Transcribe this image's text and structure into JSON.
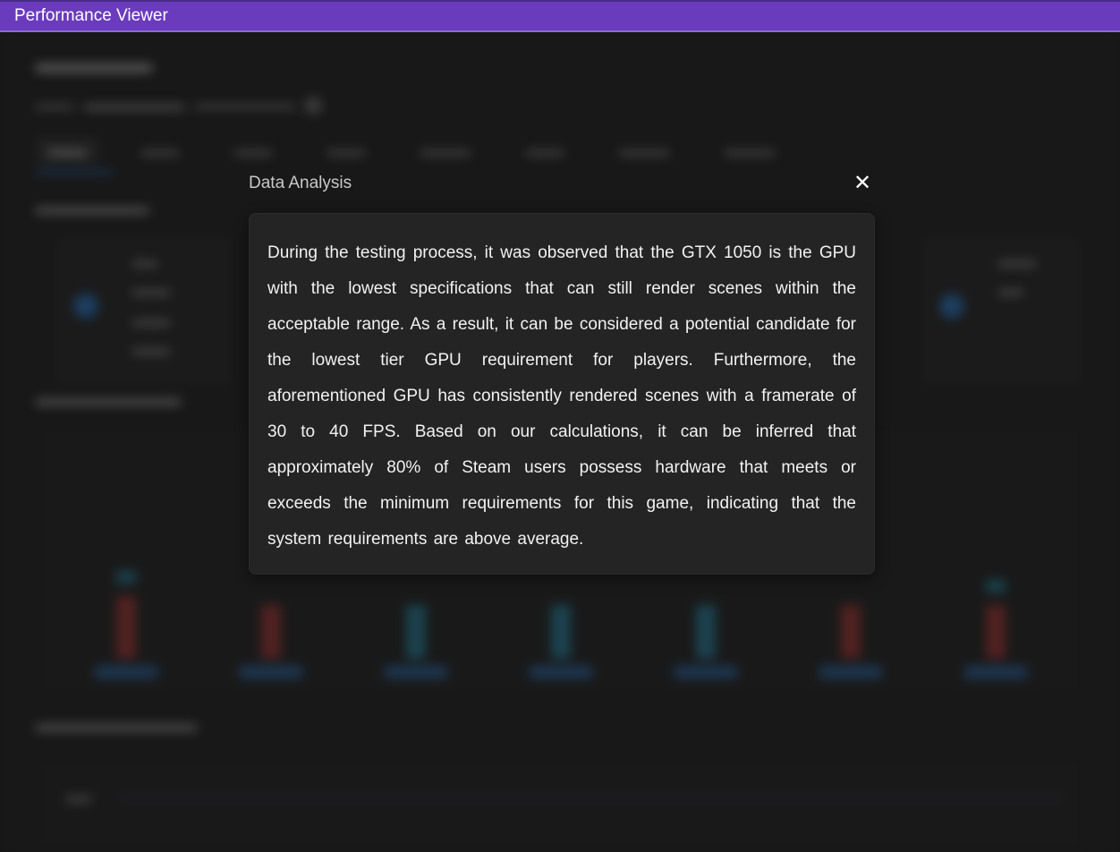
{
  "window": {
    "title": "Performance Viewer"
  },
  "dialog": {
    "title": "Data Analysis",
    "close_icon": "close-icon",
    "text": "During the testing process, it was observed that the GTX 1050 is the GPU with the lowest specifications that can still render scenes within the acceptable range. As a result, it can be considered a potential candidate for the lowest tier GPU requirement for players. Furthermore, the aforementioned GPU has consistently rendered scenes with a framerate of 30 to 40 FPS. Based on our calculations, it can be inferred that approximately 80% of Steam users possess hardware that meets or exceeds the minimum requirements for this game, indicating that the system requirements are above average."
  },
  "colors": {
    "titlebar": "#6a3bbd",
    "background": "#232323",
    "dialog_body": "#242424",
    "accent_blue": "#2f7fd0",
    "bar_red": "#b03a3a",
    "bar_blue": "#2a8aa8"
  }
}
